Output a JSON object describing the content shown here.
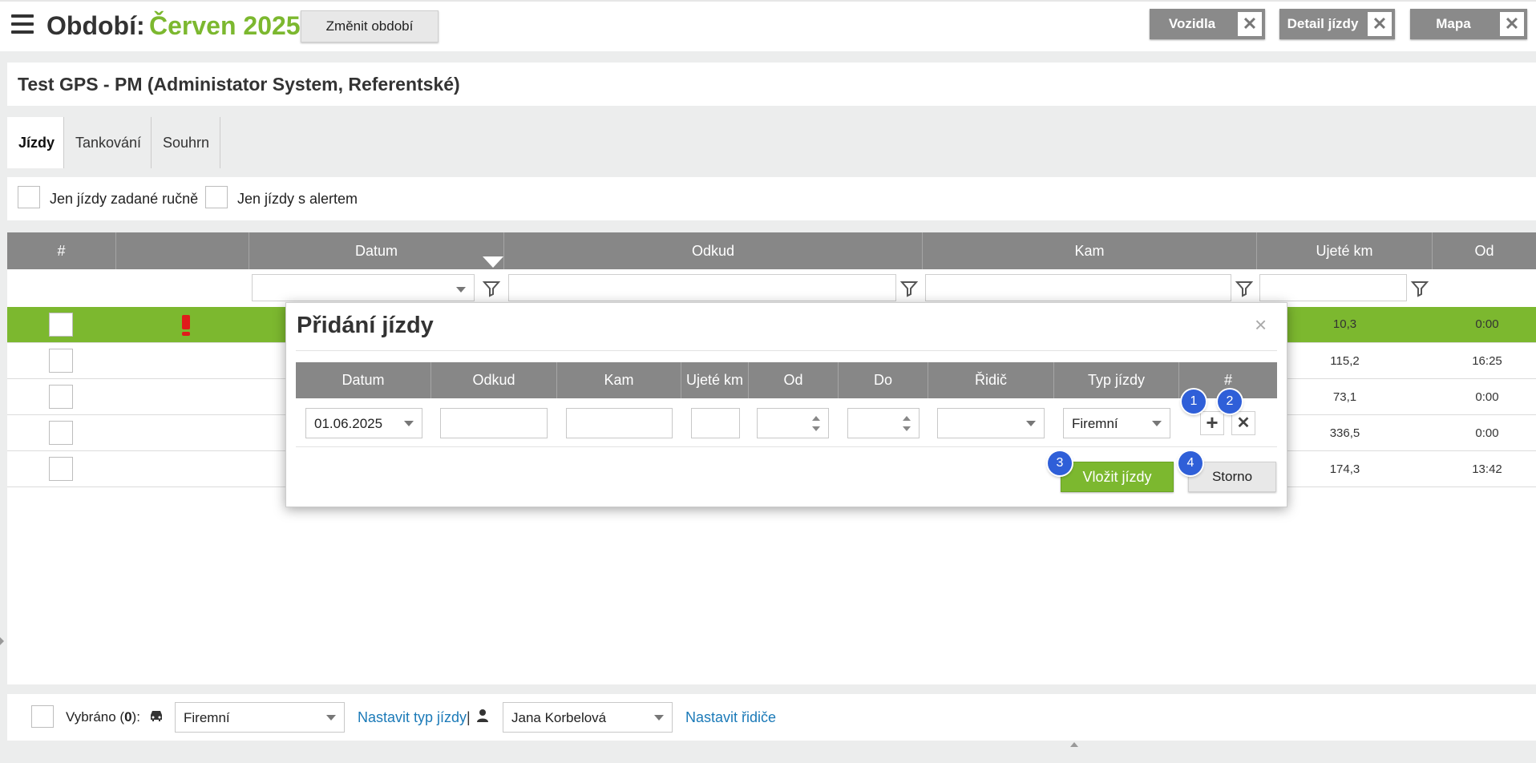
{
  "header": {
    "period_label": "Období:",
    "period_value": "Červen 2025",
    "change_period_label": "Změnit období",
    "panels": [
      {
        "label": "Vozidla"
      },
      {
        "label": "Detail jízdy"
      },
      {
        "label": "Mapa"
      }
    ]
  },
  "subject": {
    "title": "Test GPS - PM (Administator System, Referentské)"
  },
  "tabs": [
    {
      "label": "Jízdy",
      "active": true
    },
    {
      "label": "Tankování",
      "active": false
    },
    {
      "label": "Souhrn",
      "active": false
    }
  ],
  "filters": {
    "manual_only_label": "Jen jízdy zadané ručně",
    "alert_only_label": "Jen jízdy s alertem"
  },
  "grid": {
    "columns": [
      "#",
      "",
      "Datum",
      "Odkud",
      "Kam",
      "Ujeté km",
      "Od"
    ],
    "rows": [
      {
        "km": "10,3",
        "from_time": "0:00",
        "alert": true,
        "selected": true
      },
      {
        "km": "115,2",
        "from_time": "16:25",
        "alert": false,
        "selected": false
      },
      {
        "km": "73,1",
        "from_time": "0:00",
        "alert": false,
        "selected": false
      },
      {
        "km": "336,5",
        "from_time": "0:00",
        "alert": false,
        "selected": false
      },
      {
        "km": "174,3",
        "from_time": "13:42",
        "alert": false,
        "selected": false
      }
    ]
  },
  "dialog": {
    "title": "Přidání jízdy",
    "close_icon": "×",
    "columns": [
      "Datum",
      "Odkud",
      "Kam",
      "Ujeté km",
      "Od",
      "Do",
      "Řidič",
      "Typ jízdy",
      "#"
    ],
    "row": {
      "date": "01.06.2025",
      "from": "",
      "to": "",
      "km": "",
      "time_from": "",
      "time_to": "",
      "driver": "",
      "trip_type": "Firemní"
    },
    "add_icon": "+",
    "remove_icon": "✕",
    "badges": [
      "1",
      "2",
      "3",
      "4"
    ],
    "insert_label": "Vložit jízdy",
    "cancel_label": "Storno"
  },
  "bottom": {
    "selected_prefix": "Vybráno (",
    "selected_count": "0",
    "selected_suffix": "):",
    "trip_type_value": "Firemní",
    "set_trip_type_label": "Nastavit typ jízdy",
    "separator": "|",
    "driver_value": "Jana Korbelová",
    "set_driver_label": "Nastavit řidiče"
  },
  "colors": {
    "accent_green": "#7cb82f",
    "header_grey": "#878787",
    "badge_blue": "#2f5fd8",
    "link_blue": "#1b7ab8"
  }
}
